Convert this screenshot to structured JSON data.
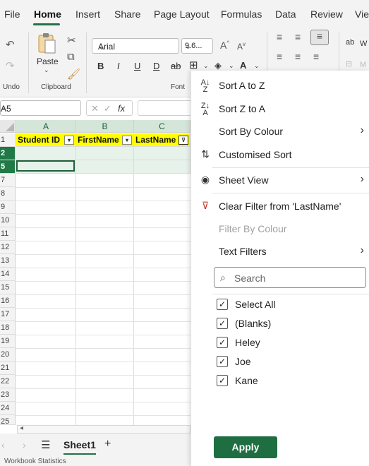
{
  "menu_tabs": [
    "File",
    "Home",
    "Insert",
    "Share",
    "Page Layout",
    "Formulas",
    "Data",
    "Review",
    "View"
  ],
  "ribbon": {
    "undo_label": "Undo",
    "clipboard_label": "Clipboard",
    "paste_label": "Paste",
    "font_label": "Font",
    "font_name": "Arial",
    "font_size": "9.6...",
    "right_partial_1": "W",
    "right_partial_2": "M"
  },
  "formula_bar": {
    "name_box": "A5",
    "cancel_glyph": "✕",
    "enter_glyph": "✓",
    "fx_glyph": "fx"
  },
  "grid": {
    "columns": [
      "A",
      "B",
      "C"
    ],
    "header_row_number": "1",
    "headers": [
      "Student ID",
      "FirstName",
      "LastName"
    ],
    "rows": [
      "2",
      "5",
      "7",
      "8",
      "9",
      "10",
      "11",
      "12",
      "13",
      "14",
      "15",
      "16",
      "17",
      "18",
      "19",
      "20",
      "21",
      "22",
      "23",
      "24",
      "25"
    ]
  },
  "sheet_tabs": {
    "active": "Sheet1",
    "add_glyph": "+"
  },
  "status_bar": "Workbook Statistics",
  "filter_menu": {
    "items": [
      {
        "label": "Sort A to Z"
      },
      {
        "label": "Sort Z to A"
      },
      {
        "label": "Sort By Colour"
      },
      {
        "label": "Customised Sort"
      },
      {
        "label": "Sheet View"
      },
      {
        "label": "Clear Filter from 'LastName'"
      },
      {
        "label": "Filter By Colour"
      },
      {
        "label": "Text Filters"
      }
    ],
    "search_placeholder": "Search",
    "checkboxes": [
      {
        "label": "Select All",
        "checked": true
      },
      {
        "label": "(Blanks)",
        "checked": true
      },
      {
        "label": "Heley",
        "checked": true
      },
      {
        "label": "Joe",
        "checked": true
      },
      {
        "label": "Kane",
        "checked": true
      }
    ],
    "apply_label": "Apply"
  },
  "colors": {
    "accent": "#217346",
    "apply_bg": "#1e6e42",
    "header_fill": "#ffff00",
    "row_highlight": "#1f7a46"
  }
}
